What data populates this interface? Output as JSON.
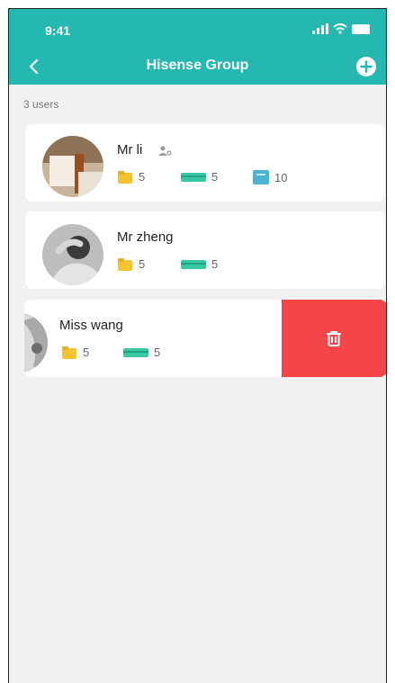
{
  "status": {
    "time": "9:41"
  },
  "nav": {
    "title": "Hisense Group"
  },
  "list": {
    "count_label": "3 users"
  },
  "users": [
    {
      "name": "Mr li",
      "folders": "5",
      "cards": "5",
      "books": "10"
    },
    {
      "name": "Mr zheng",
      "folders": "5",
      "cards": "5"
    },
    {
      "name": "Miss wang",
      "folders": "5",
      "cards": "5"
    }
  ],
  "colors": {
    "accent": "#25b8b0",
    "delete": "#f44548"
  },
  "icons": {
    "back": "chevron-left",
    "add": "plus-circle",
    "delete": "trash"
  }
}
